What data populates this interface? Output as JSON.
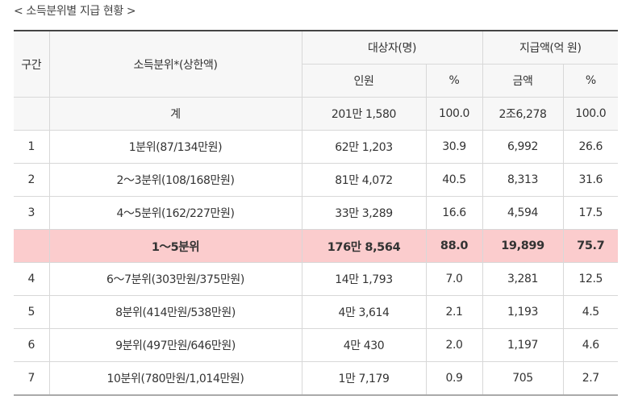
{
  "caption": "< 소득분위별 지급 현황 >",
  "header": {
    "col_group": "구간",
    "col_income": "소득분위*(상한액)",
    "col_recipients": "대상자(명)",
    "col_amount": "지급액(억 원)",
    "sub_people": "인원",
    "sub_pct1": "%",
    "sub_money": "금액",
    "sub_pct2": "%"
  },
  "total": {
    "label": "계",
    "people": "201만 1,580",
    "pct1": "100.0",
    "amount": "2조6,278",
    "pct2": "100.0"
  },
  "rows": [
    {
      "group": "1",
      "income": "1분위(87/134만원)",
      "people": "62만 1,203",
      "pct1": "30.9",
      "amount": "6,992",
      "pct2": "26.6"
    },
    {
      "group": "2",
      "income": "2～3분위(108/168만원)",
      "people": "81만 4,072",
      "pct1": "40.5",
      "amount": "8,313",
      "pct2": "31.6"
    },
    {
      "group": "3",
      "income": "4～5분위(162/227만원)",
      "people": "33만 3,289",
      "pct1": "16.6",
      "amount": "4,594",
      "pct2": "17.5"
    },
    {
      "group": "",
      "income": "1～5분위",
      "people": "176만 8,564",
      "pct1": "88.0",
      "amount": "19,899",
      "pct2": "75.7"
    },
    {
      "group": "4",
      "income": "6～7분위(303만원/375만원)",
      "people": "14만 1,793",
      "pct1": "7.0",
      "amount": "3,281",
      "pct2": "12.5"
    },
    {
      "group": "5",
      "income": "8분위(414만원/538만원)",
      "people": "4만 3,614",
      "pct1": "2.1",
      "amount": "1,193",
      "pct2": "4.5"
    },
    {
      "group": "6",
      "income": "9분위(497만원/646만원)",
      "people": "4만 430",
      "pct1": "2.0",
      "amount": "1,197",
      "pct2": "4.6"
    },
    {
      "group": "7",
      "income": "10분위(780만원/1,014만원)",
      "people": "1만 7,179",
      "pct1": "0.9",
      "amount": "705",
      "pct2": "2.7"
    }
  ],
  "colors": {
    "highlight_row": "#fbcccd",
    "header_bg": "#f7f7f7",
    "border": "#d8d8d8"
  }
}
